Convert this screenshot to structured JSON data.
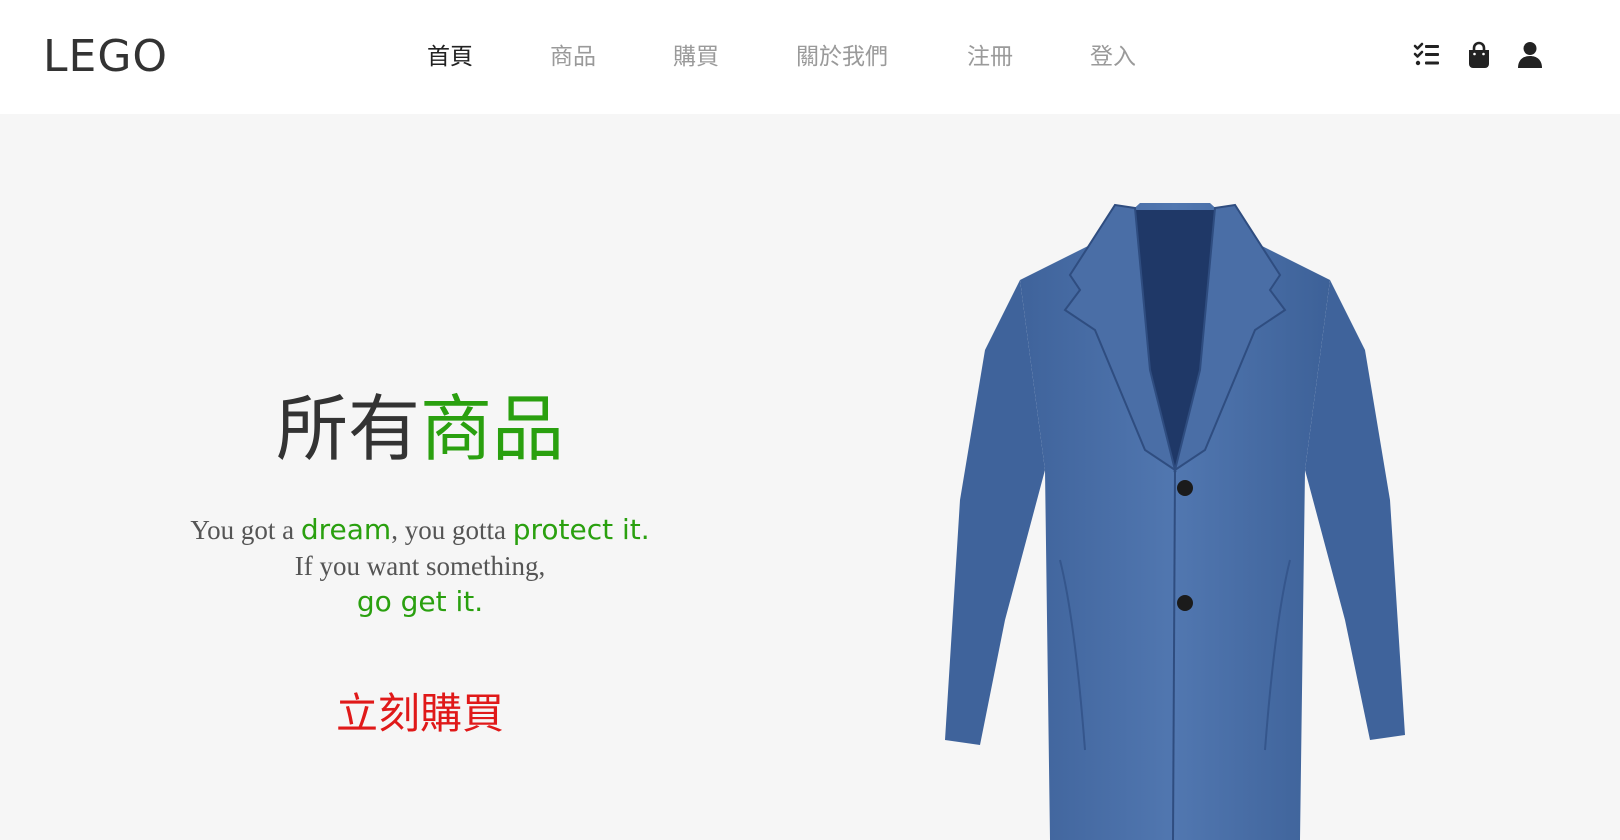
{
  "brand": {
    "logo": "LEGO"
  },
  "nav": {
    "items": [
      {
        "label": "首頁",
        "active": true
      },
      {
        "label": "商品",
        "active": false
      },
      {
        "label": "購買",
        "active": false
      },
      {
        "label": "關於我們",
        "active": false
      },
      {
        "label": "注冊",
        "active": false
      },
      {
        "label": "登入",
        "active": false
      }
    ],
    "icons": [
      "checklist-icon",
      "shopping-bag-icon",
      "user-icon"
    ]
  },
  "hero": {
    "title_part1": "所有",
    "title_part2": "商品",
    "slogan": {
      "line1_a": "You got a ",
      "line1_b": "dream",
      "line1_c": ", you gotta ",
      "line1_d": "protect it.",
      "line2": "If you want something,",
      "line3": "go get it."
    },
    "cta": "立刻購買"
  },
  "colors": {
    "accent_green": "#2aa00f",
    "cta_red": "#e01919",
    "hero_bg": "#f6f6f6",
    "coat_blue": "#4a6fa5"
  }
}
